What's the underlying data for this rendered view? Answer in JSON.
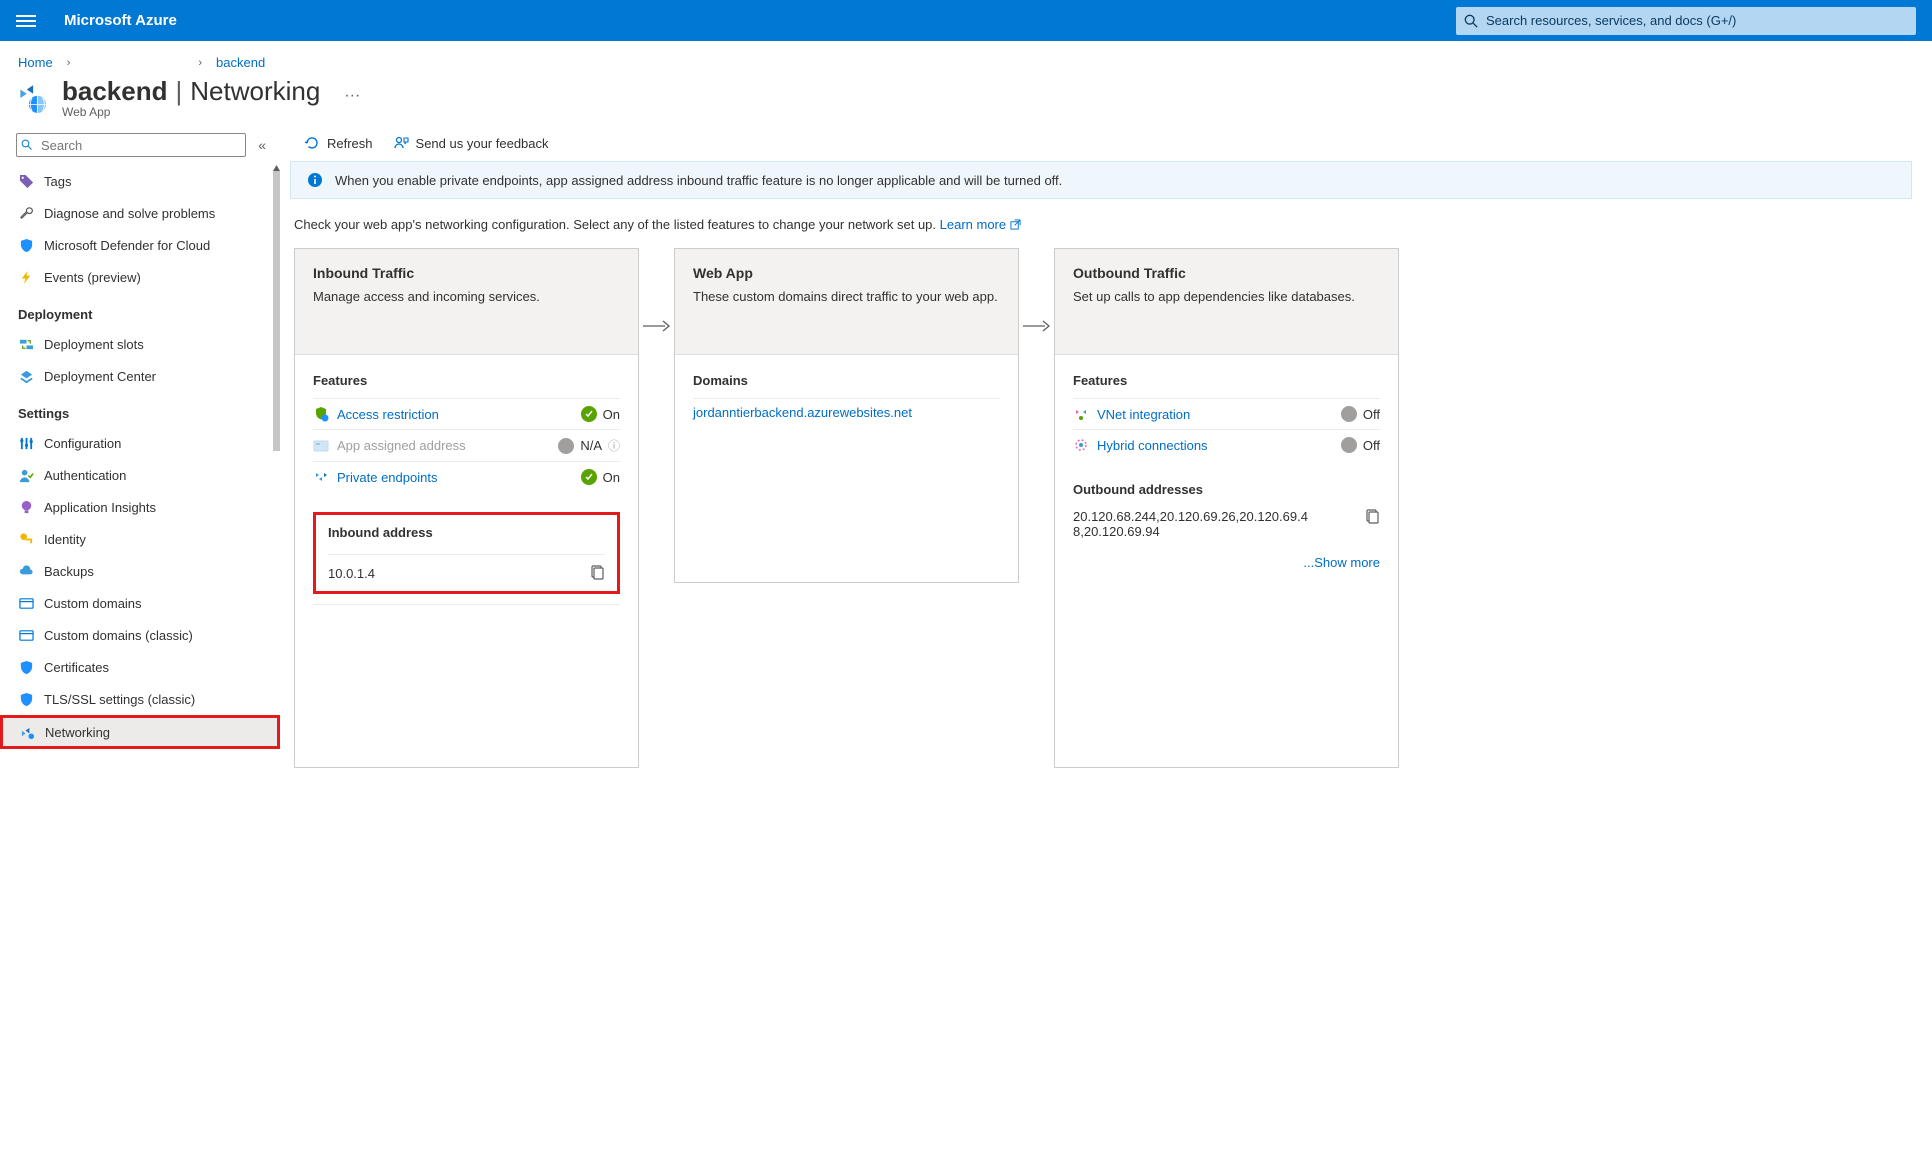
{
  "header": {
    "brand": "Microsoft Azure",
    "search_placeholder": "Search resources, services, and docs (G+/)"
  },
  "breadcrumb": {
    "home": "Home",
    "current": "backend"
  },
  "page": {
    "title": "backend",
    "section": "Networking",
    "subtitle": "Web App",
    "more": "···"
  },
  "sidebar": {
    "search_placeholder": "Search",
    "items_top": [
      {
        "label": "Tags"
      },
      {
        "label": "Diagnose and solve problems"
      },
      {
        "label": "Microsoft Defender for Cloud"
      },
      {
        "label": "Events (preview)"
      }
    ],
    "section_deployment": "Deployment",
    "items_deployment": [
      {
        "label": "Deployment slots"
      },
      {
        "label": "Deployment Center"
      }
    ],
    "section_settings": "Settings",
    "items_settings": [
      {
        "label": "Configuration"
      },
      {
        "label": "Authentication"
      },
      {
        "label": "Application Insights"
      },
      {
        "label": "Identity"
      },
      {
        "label": "Backups"
      },
      {
        "label": "Custom domains"
      },
      {
        "label": "Custom domains (classic)"
      },
      {
        "label": "Certificates"
      },
      {
        "label": "TLS/SSL settings (classic)"
      },
      {
        "label": "Networking"
      }
    ]
  },
  "toolbar": {
    "refresh": "Refresh",
    "feedback": "Send us your feedback"
  },
  "info_bar": "When you enable private endpoints, app assigned address inbound traffic feature is no longer applicable and will be turned off.",
  "intro": {
    "text": "Check your web app's networking configuration. Select any of the listed features to change your network set up. ",
    "link": "Learn more"
  },
  "inbound": {
    "title": "Inbound Traffic",
    "desc": "Manage access and incoming services.",
    "features_label": "Features",
    "features": [
      {
        "name": "Access restriction",
        "status": "On",
        "state": "green",
        "link": true
      },
      {
        "name": "App assigned address",
        "status": "N/A",
        "state": "gray",
        "link": false,
        "info": true
      },
      {
        "name": "Private endpoints",
        "status": "On",
        "state": "green",
        "link": true
      }
    ],
    "address_label": "Inbound address",
    "address": "10.0.1.4"
  },
  "webapp": {
    "title": "Web App",
    "desc": "These custom domains direct traffic to your web app.",
    "domains_label": "Domains",
    "domain": "jordanntierbackend.azurewebsites.net"
  },
  "outbound": {
    "title": "Outbound Traffic",
    "desc": "Set up calls to app dependencies like databases.",
    "features_label": "Features",
    "features": [
      {
        "name": "VNet integration",
        "status": "Off"
      },
      {
        "name": "Hybrid connections",
        "status": "Off"
      }
    ],
    "addresses_label": "Outbound addresses",
    "addresses": "20.120.68.244,20.120.69.26,20.120.69.48,20.120.69.94",
    "show_more": "...Show more"
  }
}
